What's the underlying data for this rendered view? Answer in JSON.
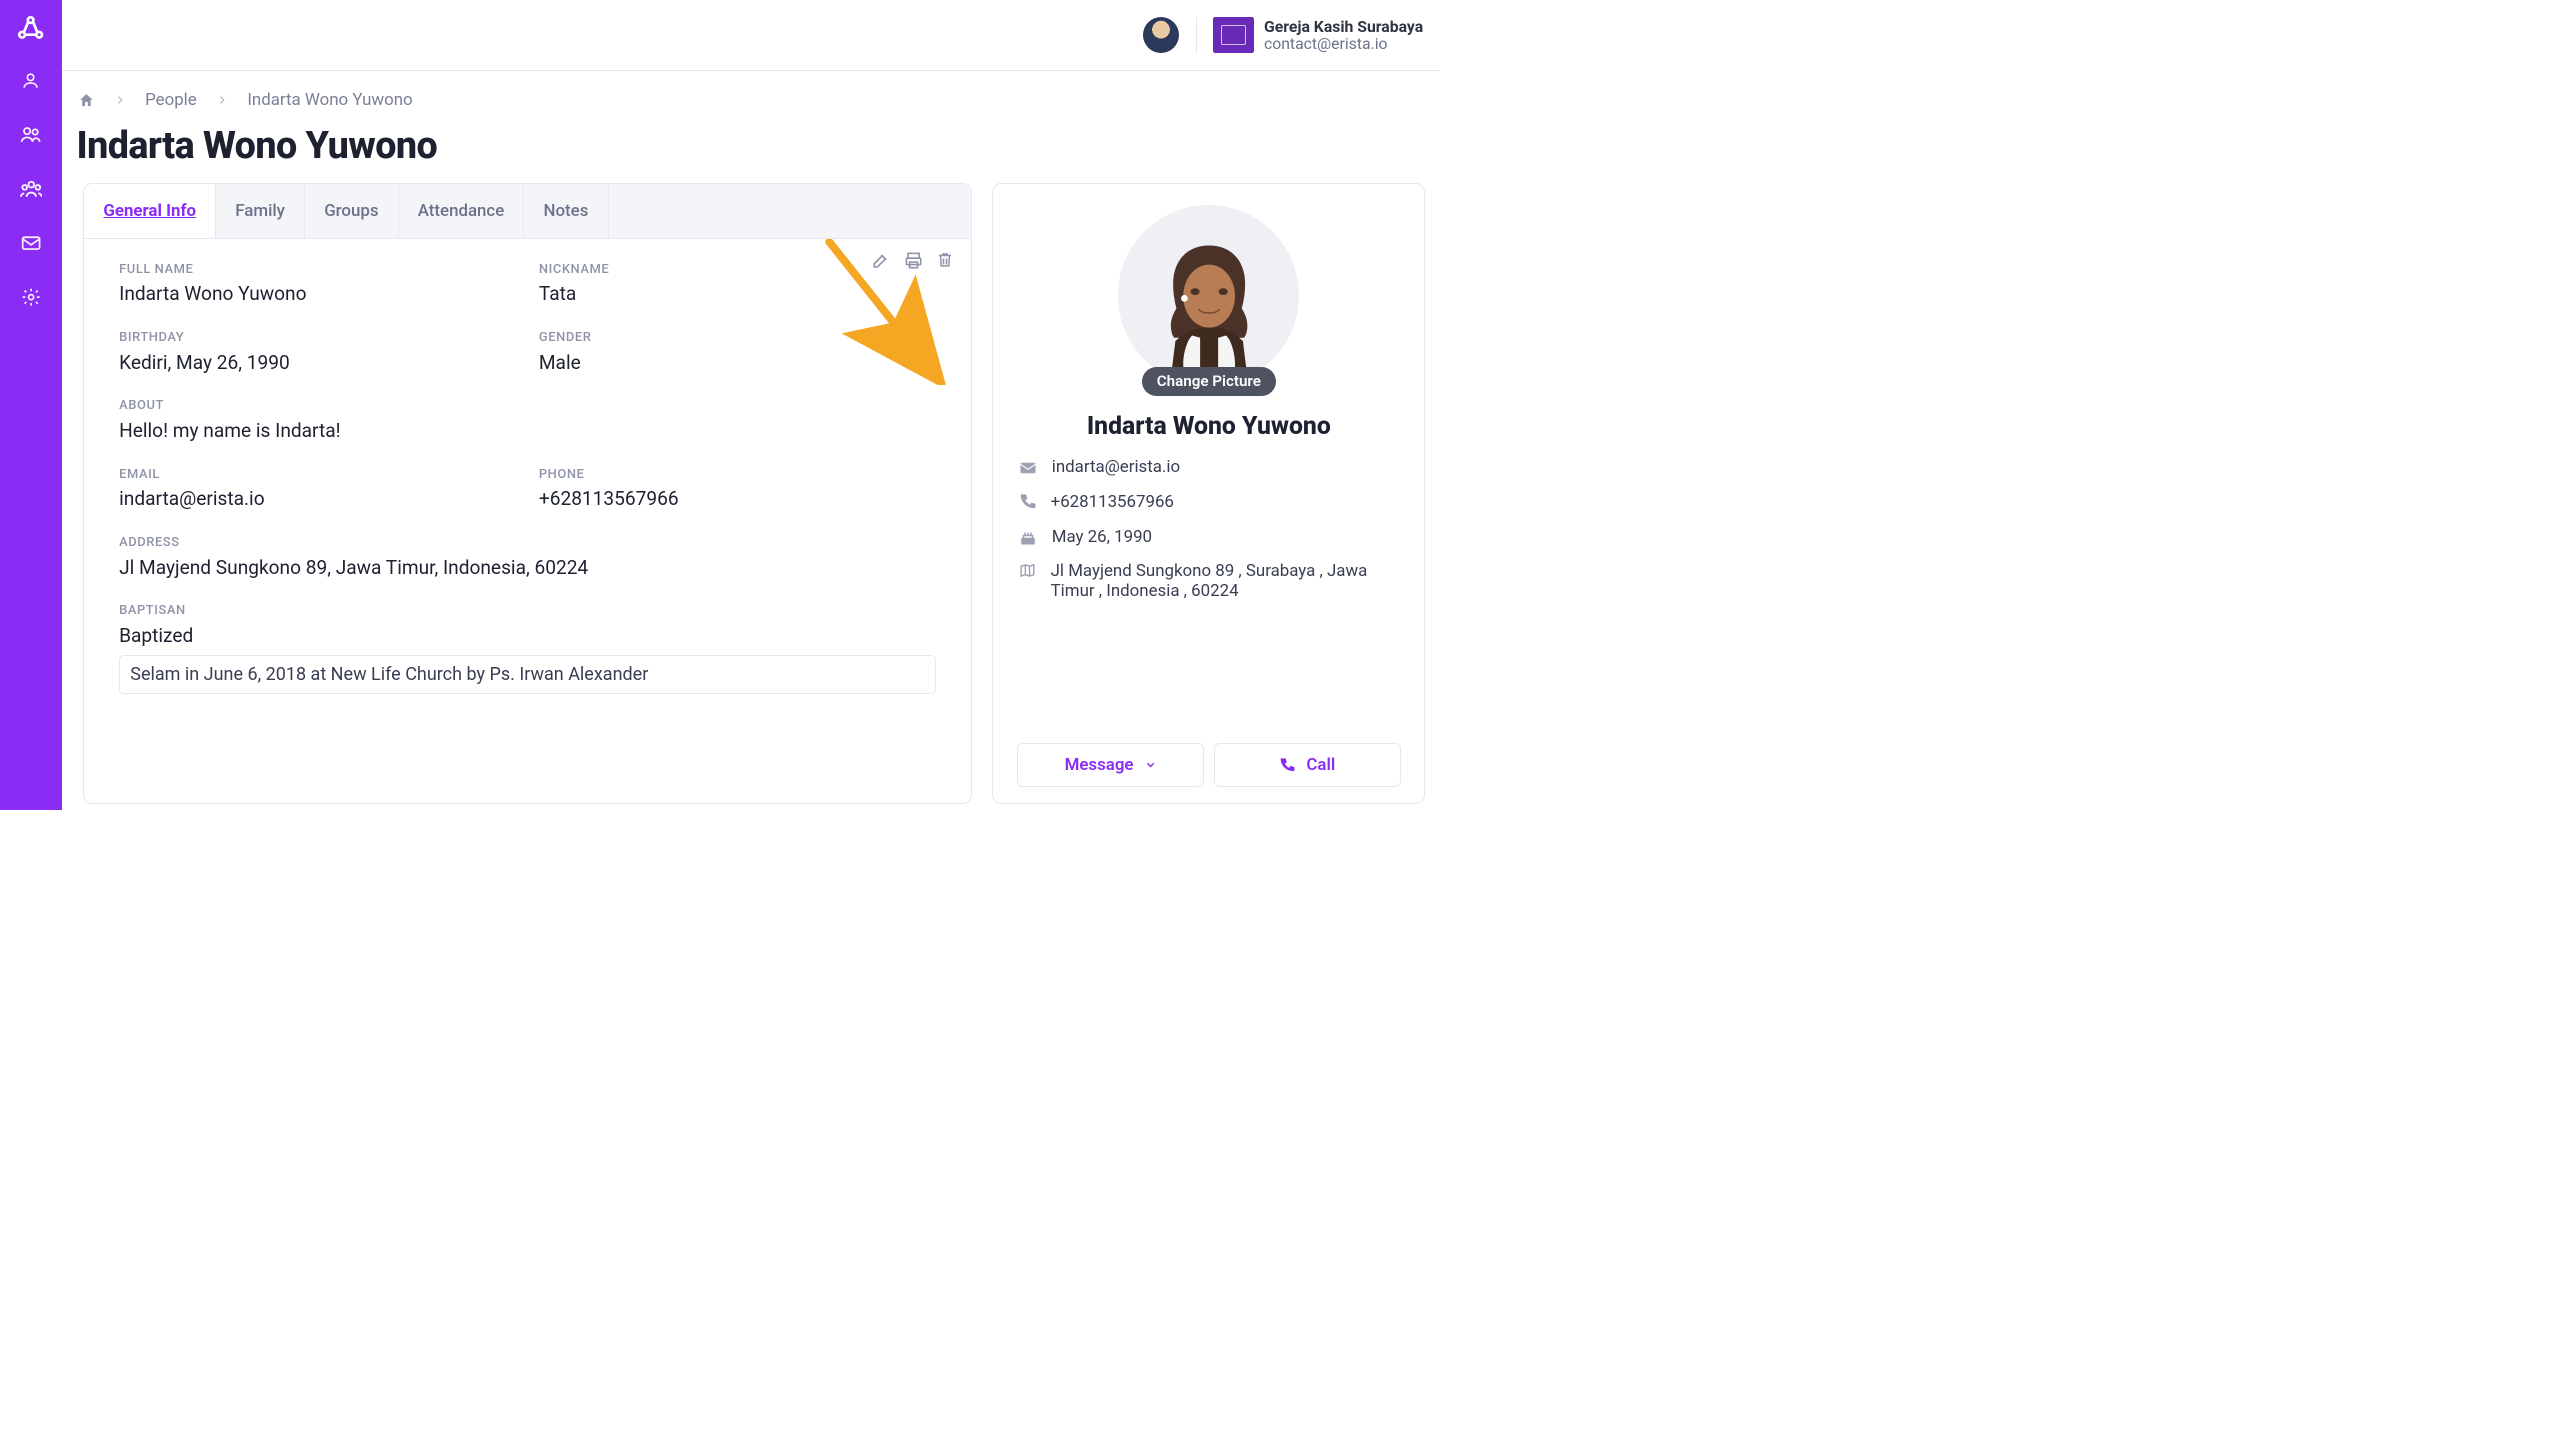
{
  "header": {
    "org_name": "Gereja Kasih Surabaya",
    "org_email": "contact@erista.io"
  },
  "breadcrumb": {
    "home": "home",
    "l1": "People",
    "l2": "Indarta Wono Yuwono"
  },
  "page": {
    "title": "Indarta Wono Yuwono"
  },
  "tabs": [
    {
      "label": "General Info",
      "active": true
    },
    {
      "label": "Family"
    },
    {
      "label": "Groups"
    },
    {
      "label": "Attendance"
    },
    {
      "label": "Notes"
    }
  ],
  "fields": {
    "full_name": {
      "label": "FULL NAME",
      "value": "Indarta Wono Yuwono"
    },
    "nickname": {
      "label": "NICKNAME",
      "value": "Tata"
    },
    "birthday": {
      "label": "BIRTHDAY",
      "value": "Kediri, May 26, 1990"
    },
    "gender": {
      "label": "GENDER",
      "value": "Male"
    },
    "about": {
      "label": "ABOUT",
      "value": "Hello! my name is Indarta!"
    },
    "email": {
      "label": "EMAIL",
      "value": "indarta@erista.io"
    },
    "phone": {
      "label": "PHONE",
      "value": "+628113567966"
    },
    "address": {
      "label": "ADDRESS",
      "value": "Jl Mayjend Sungkono 89, Jawa Timur, Indonesia, 60224"
    },
    "baptisan": {
      "label": "BAPTISAN",
      "value": "Baptized",
      "detail": "Selam in June 6, 2018 at New Life Church by Ps. Irwan Alexander"
    }
  },
  "summary": {
    "change_picture": "Change Picture",
    "name": "Indarta Wono Yuwono",
    "email": "indarta@erista.io",
    "phone": "+628113567966",
    "birthday": "May 26, 1990",
    "address": "Jl Mayjend Sungkono 89 , Surabaya , Jawa Timur , Indonesia , 60224",
    "message_btn": "Message",
    "call_btn": "Call"
  }
}
